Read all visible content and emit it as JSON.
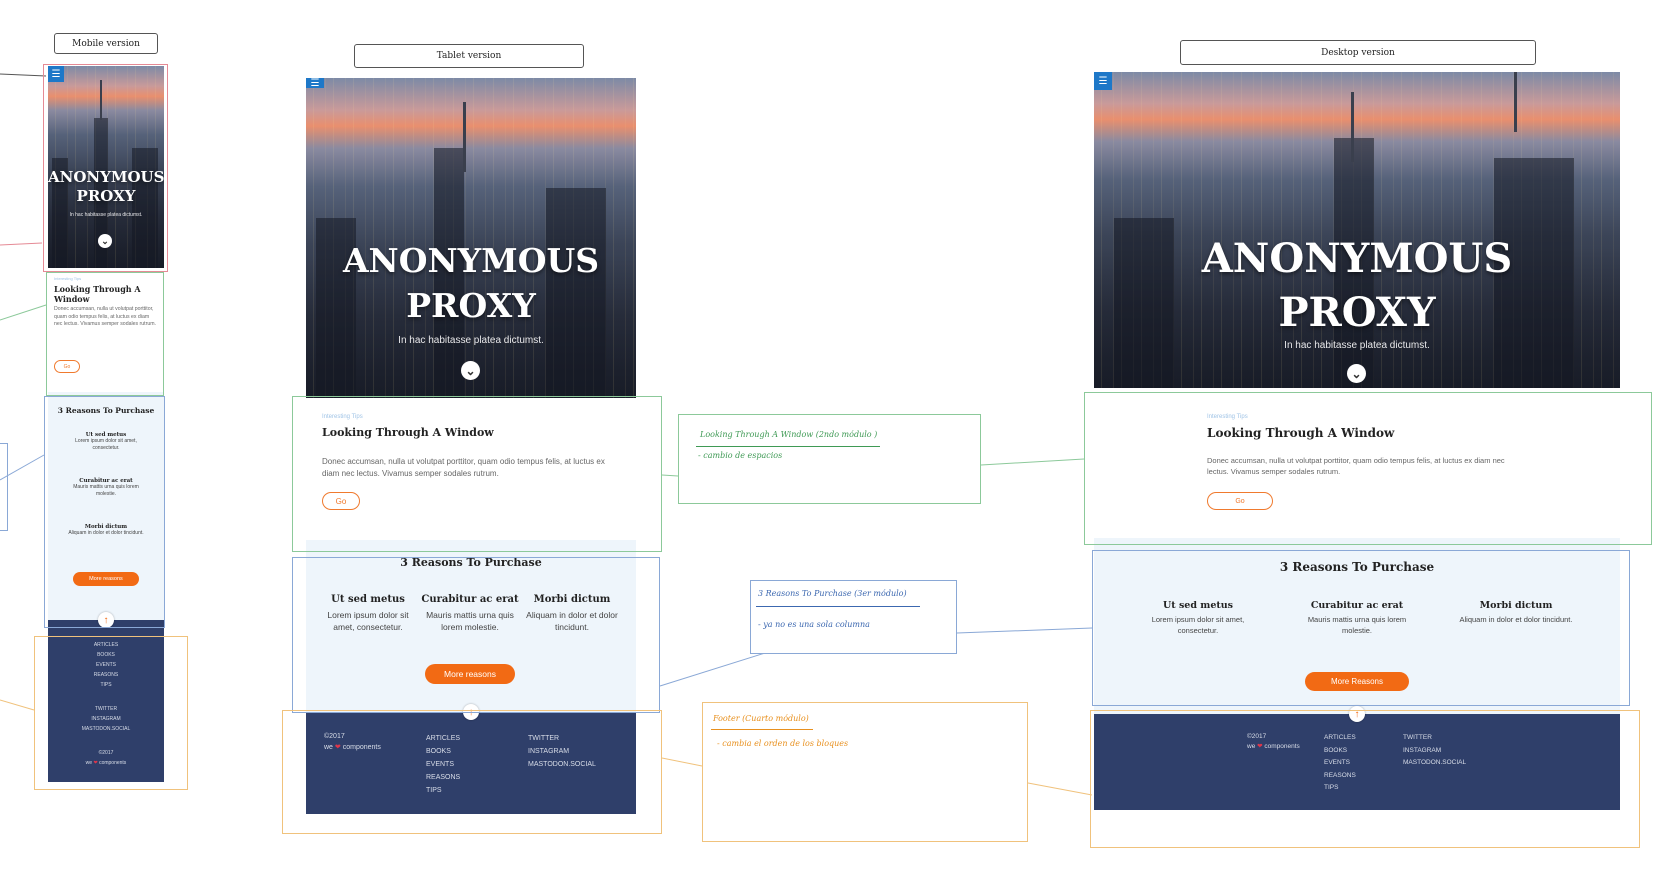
{
  "labels": {
    "mobile": "Mobile version",
    "tablet": "Tablet version",
    "desktop": "Desktop version"
  },
  "hero": {
    "title_line1": "ANONYMOUS",
    "title_line2": "PROXY",
    "subtitle": "In hac habitasse platea dictumst.",
    "menu_icon": "☰",
    "chevron_icon": "⌄"
  },
  "window_section": {
    "kicker": "Interesting Tips",
    "title": "Looking Through A Window",
    "title_mobile_line1": "Looking Through A",
    "title_mobile_line2": "Window",
    "body": "Donec accumsan, nulla ut volutpat porttitor, quam odio tempus felis, at luctus ex diam nec lectus. Vivamus semper sodales rutrum.",
    "go_label": "Go"
  },
  "reasons": {
    "title": "3 Reasons To Purchase",
    "items": [
      {
        "title": "Ut sed metus",
        "text": "Lorem ipsum dolor sit amet, consectetur."
      },
      {
        "title": "Curabitur ac erat",
        "text": "Mauris mattis urna quis lorem molestie."
      },
      {
        "title": "Morbi dictum",
        "text": "Aliquam in dolor et dolor tincidunt."
      }
    ],
    "more_label": "More reasons",
    "more_label_desktop": "More Reasons",
    "up_icon": "↑"
  },
  "footer": {
    "copyright": "©2017",
    "brand_pre": "we",
    "brand_heart": "❤",
    "brand_post": "components",
    "links": [
      "ARTICLES",
      "BOOKS",
      "EVENTS",
      "REASONS",
      "TIPS"
    ],
    "social": [
      "TWITTER",
      "INSTAGRAM",
      "MASTODON.SOCIAL"
    ]
  },
  "notes": {
    "window_title": "Looking Through A Window (2ndo módulo )",
    "window_detail": "- cambio de espacios",
    "reasons_title": "3 Reasons To Purchase (3er módulo)",
    "reasons_detail": "- ya no es una sola columna",
    "footer_title": "Footer (Cuarto módulo)",
    "footer_detail": "- cambia el orden de los bloques"
  },
  "colors": {
    "accent_orange": "#f26a14",
    "footer_navy": "#2f3f6a",
    "menu_blue": "#1e78c8",
    "note_green": "#3f9a55",
    "note_blue": "#3c68b0",
    "note_orange": "#e8901e"
  }
}
